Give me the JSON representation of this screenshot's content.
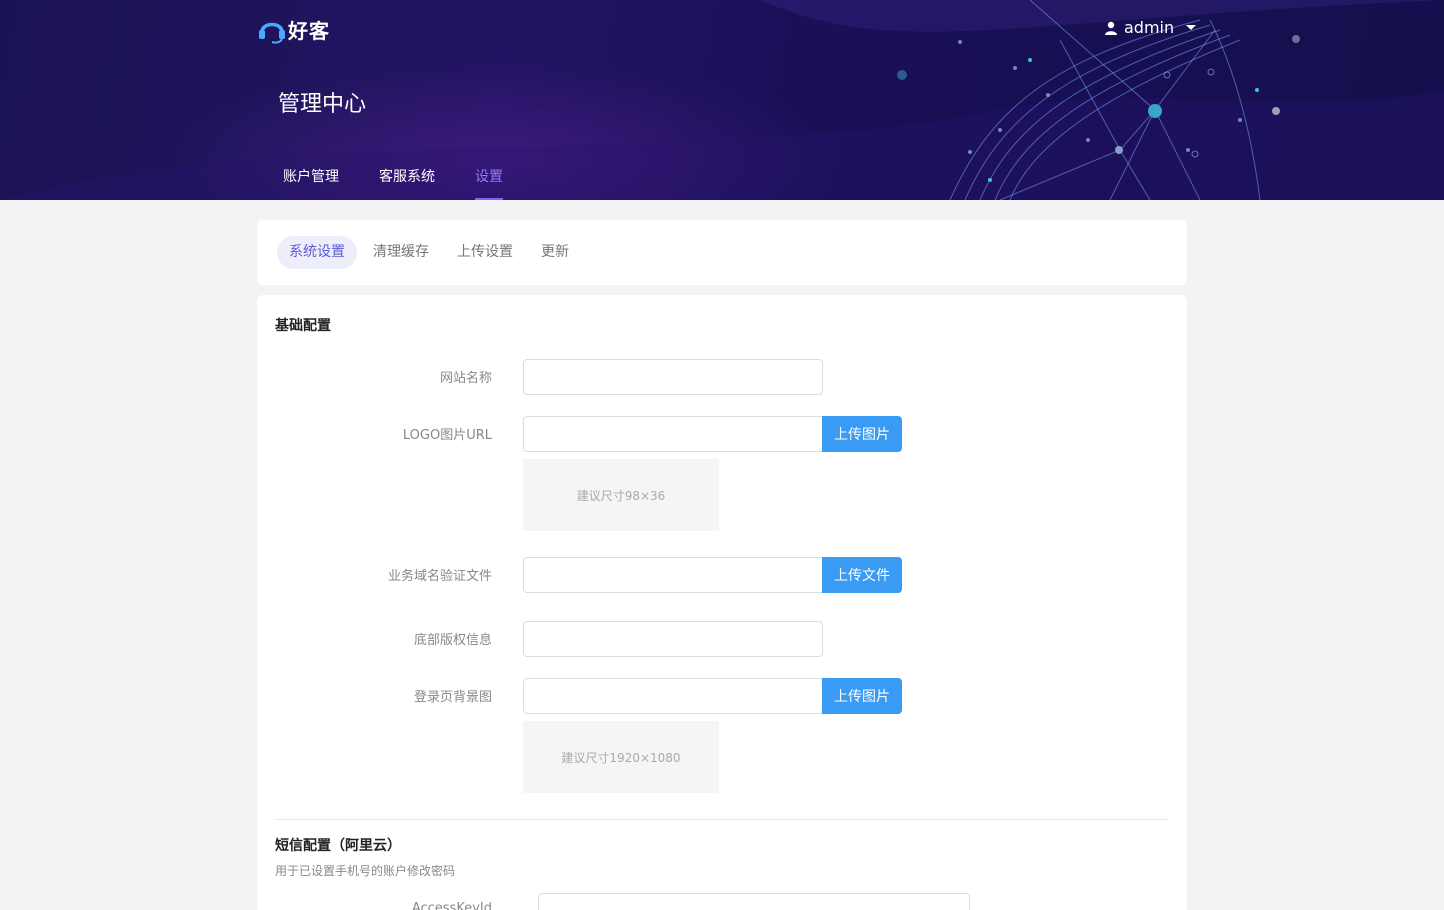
{
  "header": {
    "logo_text": "好客",
    "user_name": "admin",
    "title": "管理中心",
    "nav": [
      "账户管理",
      "客服系统",
      "设置"
    ]
  },
  "subtabs": [
    "系统设置",
    "清理缓存",
    "上传设置",
    "更新"
  ],
  "basic": {
    "title": "基础配置",
    "site_name_label": "网站名称",
    "logo_label": "LOGO图片URL",
    "upload_image": "上传图片",
    "logo_hint": "建议尺寸98×36",
    "domain_file_label": "业务域名验证文件",
    "upload_file": "上传文件",
    "copyright_label": "底部版权信息",
    "login_bg_label": "登录页背景图",
    "login_bg_hint": "建议尺寸1920×1080"
  },
  "sms": {
    "title": "短信配置（阿里云）",
    "desc": "用于已设置手机号的账户修改密码",
    "access_key_label": "AccessKeyId"
  },
  "colors": {
    "accent": "#7b68ee",
    "button": "#3a9bf5",
    "header_bg": "#1b1454"
  }
}
